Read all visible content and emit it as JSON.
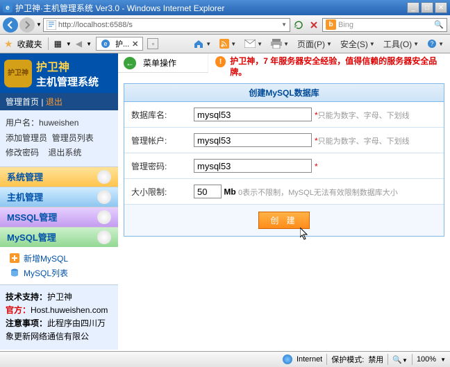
{
  "window": {
    "title": "护卫神·主机管理系统 Ver3.0 - Windows Internet Explorer"
  },
  "address": {
    "url": "http://localhost:6588/s",
    "search_placeholder": "Bing"
  },
  "favbar": {
    "favorites": "收藏夹",
    "tab_label": "护...",
    "menu_page": "页面(P)",
    "menu_safety": "安全(S)",
    "menu_tools": "工具(O)"
  },
  "sidebar": {
    "brand_line1": "护卫神",
    "brand_line2": "主机管理系统",
    "home": "管理首页",
    "logout": "退出",
    "username_label": "用户名：",
    "username": "huweishen",
    "add_admin": "添加管理员",
    "admin_list": "管理员列表",
    "change_pwd": "修改密码",
    "exit_sys": "退出系统",
    "nav_sys": "系统管理",
    "nav_host": "主机管理",
    "nav_mssql": "MSSQL管理",
    "nav_mysql": "MySQL管理",
    "sub_add_mysql": "新增MySQL",
    "sub_mysql_list": "MySQL列表",
    "support_label": "技术支持：",
    "support_val": "护卫神",
    "official_label": "官方：",
    "official_val": "Host.huweishen.com",
    "notice_label": "注意事项：",
    "notice_val": "此程序由四川万象更新网络通信有限公"
  },
  "crumb": {
    "menu_op": "菜单操作",
    "alert": "护卫神，7 年服务器安全经验，值得信赖的服务器安全品牌。"
  },
  "form": {
    "title": "创建MySQL数据库",
    "db_label": "数据库名:",
    "db_value": "mysql53",
    "db_hint": "只能为数字、字母、下划线",
    "acct_label": "管理帐户:",
    "acct_value": "mysql53",
    "acct_hint": "只能为数字、字母、下划线",
    "pwd_label": "管理密码:",
    "pwd_value": "mysql53",
    "size_label": "大小限制:",
    "size_value": "50",
    "size_unit": "Mb",
    "size_hint": "0表示不限制，MySQL无法有效限制数据库大小",
    "submit": "创 建"
  },
  "status": {
    "protect_label": "保护模式:",
    "protect_value": "禁用",
    "zone": "Internet",
    "zoom": "100%"
  }
}
